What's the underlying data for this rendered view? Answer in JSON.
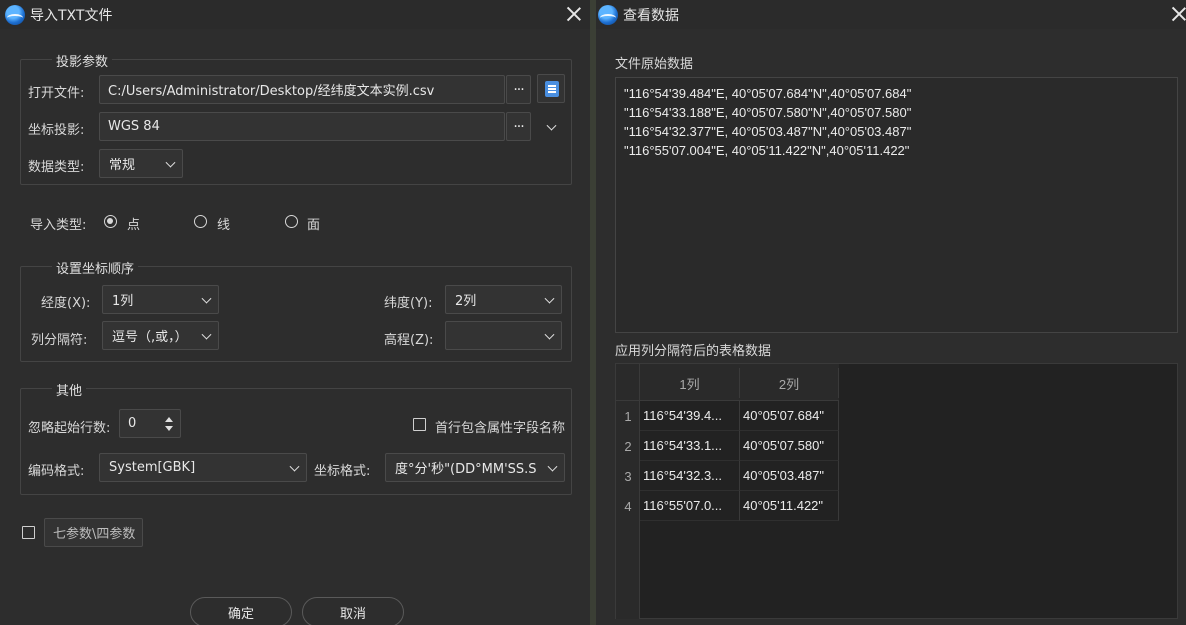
{
  "left_dialog": {
    "title": "导入TXT文件",
    "projection_group": {
      "title": "投影参数",
      "open_file_label": "打开文件:",
      "open_file_value": "C:/Users/Administrator/Desktop/经纬度文本实例.csv",
      "browse_label": "···",
      "coord_proj_label": "坐标投影:",
      "coord_proj_value": "WGS 84",
      "data_type_label": "数据类型:",
      "data_type_value": "常规"
    },
    "import_type": {
      "label": "导入类型:",
      "options": [
        "点",
        "线",
        "面"
      ],
      "selected": "点"
    },
    "coord_order_group": {
      "title": "设置坐标顺序",
      "lon_label": "经度(X):",
      "lon_value": "1列",
      "lat_label": "纬度(Y):",
      "lat_value": "2列",
      "sep_label": "列分隔符:",
      "sep_value": "逗号（,或，）",
      "elev_label": "高程(Z):",
      "elev_value": ""
    },
    "other_group": {
      "title": "其他",
      "skip_rows_label": "忽略起始行数:",
      "skip_rows_value": "0",
      "header_checkbox_label": "首行包含属性字段名称",
      "encoding_label": "编码格式:",
      "encoding_value": "System[GBK]",
      "coord_format_label": "坐标格式:",
      "coord_format_value": "度°分'秒\"(DD°MM'SS.SSS\")"
    },
    "seven_params_label": "七参数\\四参数",
    "ok_label": "确定",
    "cancel_label": "取消"
  },
  "right_dialog": {
    "title": "查看数据",
    "raw_title": "文件原始数据",
    "raw_lines": [
      "\"116°54'39.484\"E, 40°05'07.684\"N\",40°05'07.684\"",
      "\"116°54'33.188\"E, 40°05'07.580\"N\",40°05'07.580\"",
      "\"116°54'32.377\"E, 40°05'03.487\"N\",40°05'03.487\"",
      "\"116°55'07.004\"E, 40°05'11.422\"N\",40°05'11.422\""
    ],
    "table_title": "应用列分隔符后的表格数据",
    "table": {
      "headers": [
        "1列",
        "2列"
      ],
      "rows": [
        {
          "index": "1",
          "col1": "116°54'39.4...",
          "col2": "40°05'07.684\""
        },
        {
          "index": "2",
          "col1": "116°54'33.1...",
          "col2": "40°05'07.580\""
        },
        {
          "index": "3",
          "col1": "116°54'32.3...",
          "col2": "40°05'03.487\""
        },
        {
          "index": "4",
          "col1": "116°55'07.0...",
          "col2": "40°05'11.422\""
        }
      ]
    }
  },
  "colors": {
    "background": "#2b2b2b",
    "field": "#333333",
    "border": "#4a4a4a",
    "accent_blue": "#1e88e5"
  }
}
